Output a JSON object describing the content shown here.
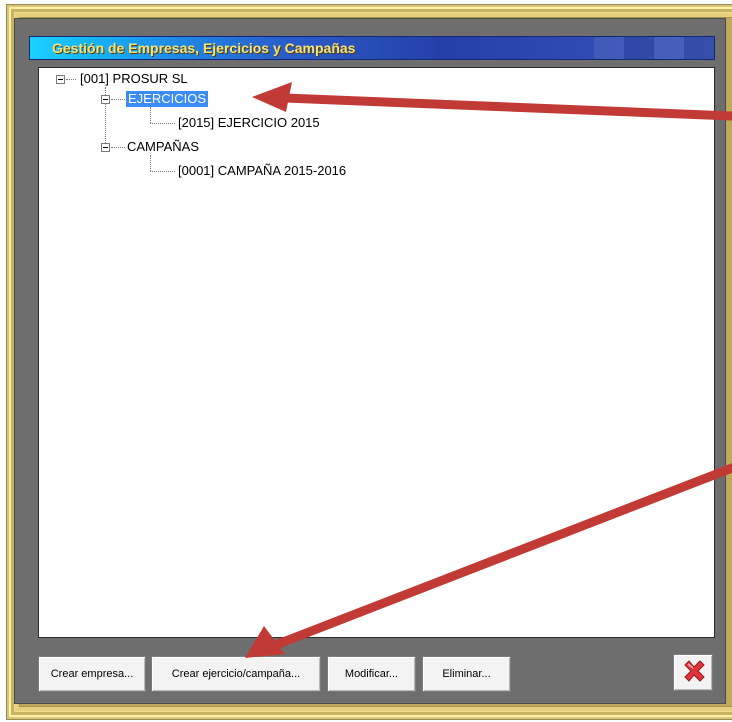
{
  "window": {
    "title": "Gestión de Empresas, Ejercicios y Campañas"
  },
  "tree": {
    "root": "[001] PROSUR SL",
    "ejercicios": "EJERCICIOS",
    "ejercicio_item": "[2015] EJERCICIO 2015",
    "campanas": "CAMPAÑAS",
    "campana_item": "[0001] CAMPAÑA 2015-2016"
  },
  "buttons": {
    "crear_empresa": "Crear empresa...",
    "crear_ejercicio": "Crear ejercicio/campaña...",
    "modificar": "Modificar...",
    "eliminar": "Eliminar..."
  },
  "colors": {
    "selection": "#3b8df3",
    "annotation_arrow": "#c23a36",
    "frame_gold": "#d8c57b"
  },
  "icons": {
    "close": "red-x-icon",
    "expand": "collapse-minus-icon"
  }
}
